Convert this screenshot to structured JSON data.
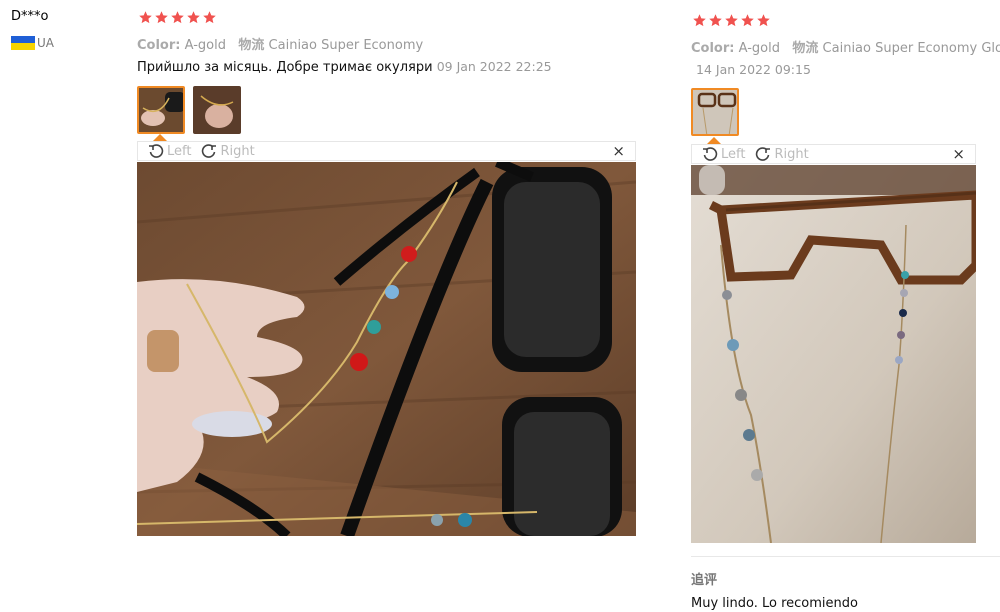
{
  "review1": {
    "user": "D***o",
    "country": "UA",
    "rating": 5,
    "color_label": "Color:",
    "color_value": "A-gold",
    "shipping_label": "物流",
    "shipping_value": "Cainiao Super Economy",
    "text": "Прийшло за місяць. Добре тримає окуляри",
    "date": "09 Jan 2022 22:25",
    "viewer": {
      "left_label": "Left",
      "right_label": "Right",
      "close_label": "×"
    }
  },
  "review2": {
    "rating": 5,
    "color_label": "Color:",
    "color_value": "A-gold",
    "shipping_label": "物流",
    "shipping_value": "Cainiao Super Economy Global",
    "date": "14 Jan 2022 09:15",
    "viewer": {
      "left_label": "Left",
      "right_label": "Right",
      "close_label": "×"
    },
    "additional_label": "追评",
    "additional_text": "Muy lindo. Lo recomiendo"
  },
  "colors": {
    "star": "#f0524f",
    "accent": "#f08a24"
  }
}
